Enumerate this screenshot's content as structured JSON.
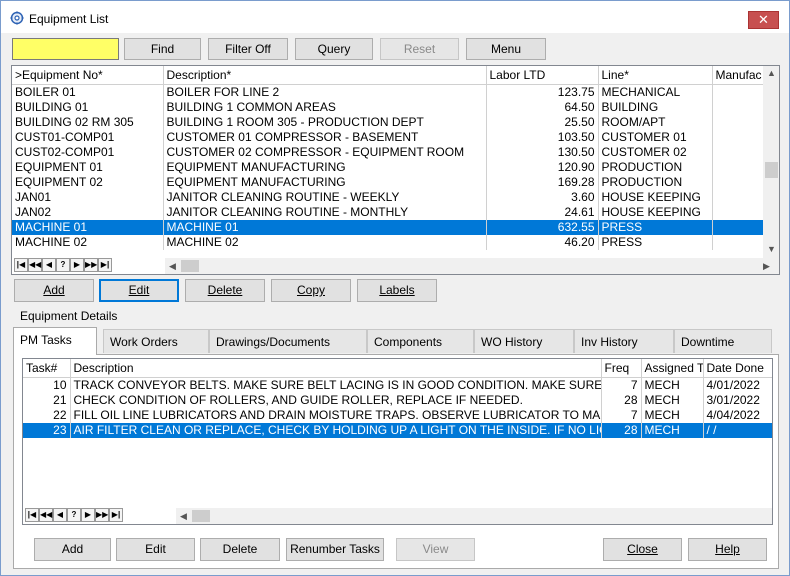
{
  "window": {
    "title": "Equipment List",
    "close_glyph": "✕"
  },
  "toolbar": {
    "find_value": "",
    "find": "Find",
    "filter_off": "Filter Off",
    "query": "Query",
    "reset": "Reset",
    "menu": "Menu"
  },
  "equipment_grid": {
    "columns": [
      ">Equipment No*",
      "Description*",
      "Labor LTD",
      "Line*",
      "Manufac"
    ],
    "rows": [
      [
        "BOILER 01",
        "BOILER FOR LINE 2",
        "123.75",
        "MECHANICAL",
        ""
      ],
      [
        "BUILDING 01",
        "BUILDING 1 COMMON AREAS",
        "64.50",
        "BUILDING",
        ""
      ],
      [
        "BUILDING 02 RM 305",
        "BUILDING 1 ROOM 305 - PRODUCTION DEPT",
        "25.50",
        "ROOM/APT",
        ""
      ],
      [
        "CUST01-COMP01",
        "CUSTOMER 01 COMPRESSOR - BASEMENT",
        "103.50",
        "CUSTOMER 01",
        ""
      ],
      [
        "CUST02-COMP01",
        "CUSTOMER 02 COMPRESSOR - EQUIPMENT ROOM",
        "130.50",
        "CUSTOMER 02",
        ""
      ],
      [
        "EQUIPMENT 01",
        "EQUIPMENT MANUFACTURING",
        "120.90",
        "PRODUCTION",
        ""
      ],
      [
        "EQUIPMENT 02",
        "EQUIPMENT MANUFACTURING",
        "169.28",
        "PRODUCTION",
        ""
      ],
      [
        "JAN01",
        "JANITOR CLEANING ROUTINE - WEEKLY",
        "3.60",
        "HOUSE KEEPING",
        ""
      ],
      [
        "JAN02",
        "JANITOR CLEANING ROUTINE - MONTHLY",
        "24.61",
        "HOUSE KEEPING",
        ""
      ],
      [
        "MACHINE 01",
        "MACHINE 01",
        "632.55",
        "PRESS",
        ""
      ],
      [
        "MACHINE 02",
        "MACHINE 02",
        "46.20",
        "PRESS",
        ""
      ]
    ],
    "selected_row": 9
  },
  "nav_glyphs": [
    "|◀",
    "◀◀",
    "◀",
    "?",
    "▶",
    "▶▶",
    "▶|"
  ],
  "equipment_actions": {
    "add": "Add",
    "edit": "Edit",
    "delete": "Delete",
    "copy": "Copy",
    "labels": "Labels"
  },
  "details": {
    "group_label": "Equipment Details",
    "tabs": [
      "PM Tasks",
      "Work Orders",
      "Drawings/Documents",
      "Components",
      "WO History",
      "Inv History",
      "Downtime"
    ],
    "active_tab": 0
  },
  "tasks_grid": {
    "columns": [
      "Task#",
      "Description",
      "Freq",
      "Assigned T",
      "Date Done"
    ],
    "rows": [
      [
        "10",
        "TRACK CONVEYOR BELTS. MAKE SURE BELT LACING IS IN GOOD CONDITION. MAKE SURE HEAD AN",
        "7",
        "MECH",
        "4/01/2022"
      ],
      [
        "21",
        "CHECK CONDITION OF ROLLERS, AND GUIDE ROLLER, REPLACE IF NEEDED.",
        "28",
        "MECH",
        "3/01/2022"
      ],
      [
        "22",
        "FILL OIL LINE LUBRICATORS AND DRAIN MOISTURE TRAPS. OBSERVE LUBRICATOR TO MAKE SURE IT",
        "7",
        "MECH",
        "4/04/2022"
      ],
      [
        "23",
        "AIR FILTER CLEAN OR REPLACE, CHECK BY HOLDING UP A LIGHT ON THE INSIDE. IF NO LIGHT IS VIS",
        "28",
        "MECH",
        "  /  /"
      ]
    ],
    "selected_row": 3
  },
  "task_actions": {
    "add": "Add",
    "edit": "Edit",
    "delete": "Delete",
    "renumber": "Renumber Tasks",
    "view": "View"
  },
  "dialog_actions": {
    "close": "Close",
    "help": "Help"
  },
  "colors": {
    "selection": "#0078d7",
    "find_field": "#ffff66",
    "close_button": "#c75050"
  }
}
